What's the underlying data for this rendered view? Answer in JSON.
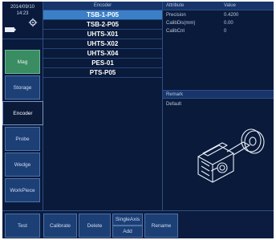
{
  "status": {
    "date": "2014/09/10",
    "time": "14:23"
  },
  "sidebar": {
    "items": [
      {
        "label": "Mag",
        "state": "green"
      },
      {
        "label": "Storage",
        "state": "normal"
      },
      {
        "label": "Encoder",
        "state": "active"
      },
      {
        "label": "Probe",
        "state": "normal"
      },
      {
        "label": "Wedge",
        "state": "normal"
      },
      {
        "label": "WorkPiece",
        "state": "normal"
      }
    ]
  },
  "encoder_panel": {
    "header": "Encoder",
    "items": [
      "TSB-1-P05",
      "TSB-2-P05",
      "UHTS-X01",
      "UHTS-X02",
      "UHTS-X04",
      "PES-01",
      "PTS-P05"
    ],
    "selected": "TSB-1-P05"
  },
  "attribute_panel": {
    "col_attribute": "Attribute",
    "col_value": "Value",
    "rows": [
      {
        "name": "Precision",
        "value": "0.4200"
      },
      {
        "name": "CalibDis(mm)",
        "value": "0.00"
      },
      {
        "name": "CalibCnt",
        "value": "0"
      }
    ]
  },
  "remark_panel": {
    "header": "Remark",
    "text": "Default"
  },
  "toolbar": {
    "test": "Test",
    "calibrate": "Calibrate",
    "delete": "Delete",
    "single_axis": "SingleAxis",
    "add": "Add",
    "rename": "Rename"
  },
  "colors": {
    "background": "#0c1e44",
    "selected_row": "#3b7fc8",
    "button": "#1c3f76",
    "active_green": "#3a8c63"
  },
  "icons": [
    "gear-icon",
    "battery-icon",
    "encoder-wheel-illustration"
  ]
}
